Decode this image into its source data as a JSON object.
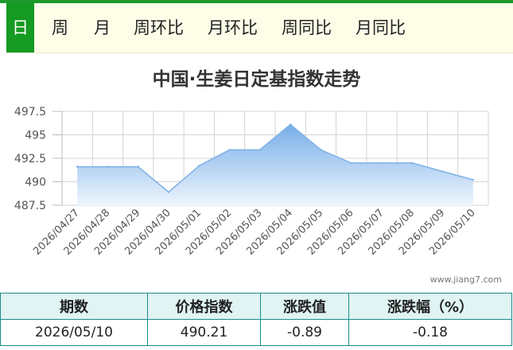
{
  "tabs": [
    {
      "label": "日",
      "active": true
    },
    {
      "label": "周",
      "active": false
    },
    {
      "label": "月",
      "active": false
    },
    {
      "label": "周环比",
      "active": false
    },
    {
      "label": "月环比",
      "active": false
    },
    {
      "label": "周同比",
      "active": false
    },
    {
      "label": "月同比",
      "active": false
    }
  ],
  "watermark": "www.jiang7.com",
  "chart_data": {
    "type": "area",
    "title": "中国·生姜日定基指数走势",
    "x": [
      "2026/04/27",
      "2026/04/28",
      "2026/04/29",
      "2026/04/30",
      "2026/05/01",
      "2026/05/02",
      "2026/05/03",
      "2026/05/04",
      "2026/05/05",
      "2026/05/06",
      "2026/05/07",
      "2026/05/08",
      "2026/05/09",
      "2026/05/10"
    ],
    "y": [
      491.6,
      491.6,
      491.6,
      488.9,
      491.7,
      493.4,
      493.4,
      496.1,
      493.4,
      492.0,
      492.0,
      492.0,
      491.1,
      490.21
    ],
    "yticks": [
      "497.5",
      "495",
      "492.5",
      "490",
      "487.5"
    ],
    "ylim": [
      487.5,
      497.5
    ],
    "grid": true,
    "colors": {
      "line": "#7fb0e6",
      "fill_top": "#77aee8",
      "fill_bottom": "#eef5fd",
      "grid": "#d4d4d4"
    }
  },
  "table": {
    "headers": [
      "期数",
      "价格指数",
      "涨跌值",
      "涨跌幅（%）"
    ],
    "row": [
      "2026/05/10",
      "490.21",
      "-0.89",
      "-0.18"
    ]
  }
}
